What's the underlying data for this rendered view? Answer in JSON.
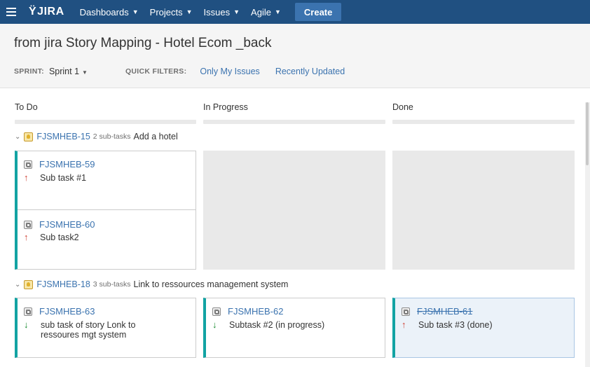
{
  "nav": {
    "logo": "JIRA",
    "items": [
      {
        "label": "Dashboards"
      },
      {
        "label": "Projects"
      },
      {
        "label": "Issues"
      },
      {
        "label": "Agile"
      }
    ],
    "create": "Create",
    "brand_color": "#205081"
  },
  "board": {
    "title": "from jira Story Mapping - Hotel Ecom _back",
    "sprint_label": "SPRINT:",
    "sprint_value": "Sprint 1",
    "quick_filters_label": "QUICK FILTERS:",
    "quick_filters": [
      "Only My Issues",
      "Recently Updated"
    ]
  },
  "columns": [
    "To Do",
    "In Progress",
    "Done"
  ],
  "swimlanes": [
    {
      "key": "FJSMHEB-15",
      "subtasks": "2 sub-tasks",
      "summary": "Add a hotel",
      "cards": [
        {
          "key": "FJSMHEB-59",
          "summary": "Sub task #1",
          "priority": "up-icon"
        },
        {
          "key": "FJSMHEB-60",
          "summary": "Sub task2",
          "priority": "up-icon"
        }
      ]
    },
    {
      "key": "FJSMHEB-18",
      "subtasks": "3 sub-tasks",
      "summary": "Link to ressources management system",
      "cards": [
        {
          "key": "FJSMHEB-63",
          "summary_line1": "sub task of story Lonk to",
          "summary_line2": "ressoures mgt system",
          "priority": "down-icon"
        },
        {
          "key": "FJSMHEB-62",
          "summary": "Subtask #2 (in progress)",
          "priority": "down-icon"
        },
        {
          "key": "FJSMHEB-61",
          "summary": "Sub task #3 (done)",
          "priority": "up-icon"
        }
      ]
    }
  ]
}
